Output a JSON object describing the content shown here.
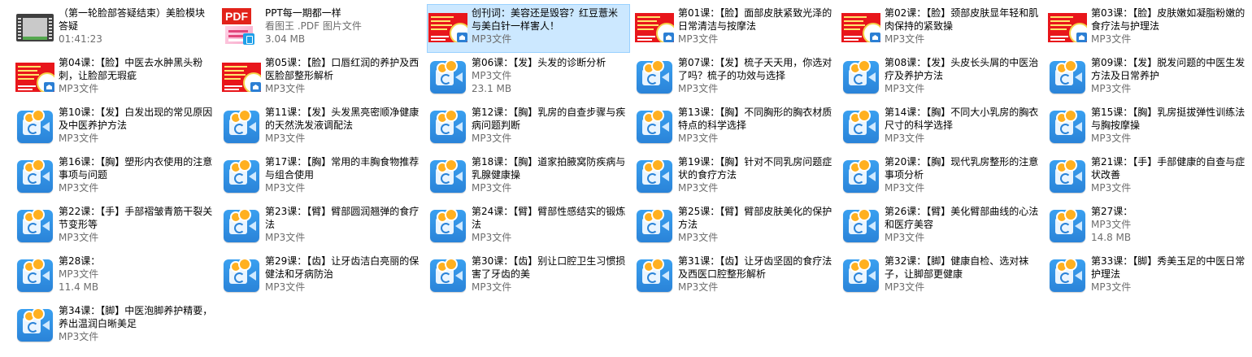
{
  "items": [
    {
      "name": "（第一轮脸部答疑结束）美脸模块答疑",
      "meta1": "01:41:23",
      "meta2": "",
      "icon": "video-thumbnail"
    },
    {
      "name": "PPT每一期都一样",
      "meta1": "看图王 .PDF 图片文件",
      "meta2": "3.04 MB",
      "icon": "pdf-thumbnail",
      "pdf_label": "PDF"
    },
    {
      "name": "创刊词：美容还是毁容？红豆薏米与美白针一样害人！",
      "meta1": "MP3文件",
      "meta2": "",
      "icon": "red-cover-thumbnail",
      "selected": true
    },
    {
      "name": "第01课：【脸】面部皮肤紧致光泽的日常清洁与按摩法",
      "meta1": "MP3文件",
      "meta2": "",
      "icon": "red-cover-thumbnail"
    },
    {
      "name": "第02课：【脸】颈部皮肤显年轻和肌肉保持的紧致操",
      "meta1": "MP3文件",
      "meta2": "",
      "icon": "red-cover-thumbnail"
    },
    {
      "name": "第03课：【脸】皮肤嫩如凝脂粉嫩的食疗法与护理法",
      "meta1": "MP3文件",
      "meta2": "",
      "icon": "red-cover-thumbnail"
    },
    {
      "name": "第04课：【脸】中医去水肿黑头粉刺，让脸部无瑕疵",
      "meta1": "MP3文件",
      "meta2": "",
      "icon": "red-cover-thumbnail"
    },
    {
      "name": "第05课：【脸】口唇红润的养护及西医脸部整形解析",
      "meta1": "MP3文件",
      "meta2": "",
      "icon": "red-cover-thumbnail"
    },
    {
      "name": "第06课：【发】头发的诊断分析",
      "meta1": "MP3文件",
      "meta2": "23.1 MB",
      "icon": "mp3-file-icon"
    },
    {
      "name": "第07课：【发】梳子天天用，你选对了吗？梳子的功效与选择",
      "meta1": "MP3文件",
      "meta2": "",
      "icon": "mp3-file-icon"
    },
    {
      "name": "第08课：【发】头皮长头屑的中医治疗及养护方法",
      "meta1": "MP3文件",
      "meta2": "",
      "icon": "mp3-file-icon"
    },
    {
      "name": "第09课：【发】脱发问题的中医生发方法及日常养护",
      "meta1": "MP3文件",
      "meta2": "",
      "icon": "mp3-file-icon"
    },
    {
      "name": "第10课：【发】白发出现的常见原因及中医养护方法",
      "meta1": "MP3文件",
      "meta2": "",
      "icon": "mp3-file-icon"
    },
    {
      "name": "第11课：【发】头发黑亮密顺净健康的天然洗发液调配法",
      "meta1": "MP3文件",
      "meta2": "",
      "icon": "mp3-file-icon"
    },
    {
      "name": "第12课：【胸】乳房的自查步骤与疾病问题判断",
      "meta1": "MP3文件",
      "meta2": "",
      "icon": "mp3-file-icon"
    },
    {
      "name": "第13课：【胸】不同胸形的胸衣材质特点的科学选择",
      "meta1": "MP3文件",
      "meta2": "",
      "icon": "mp3-file-icon"
    },
    {
      "name": "第14课：【胸】不同大小乳房的胸衣尺寸的科学选择",
      "meta1": "MP3文件",
      "meta2": "",
      "icon": "mp3-file-icon"
    },
    {
      "name": "第15课：【胸】乳房挺拔弹性训练法与胸按摩操",
      "meta1": "MP3文件",
      "meta2": "",
      "icon": "mp3-file-icon"
    },
    {
      "name": "第16课：【胸】塑形内衣使用的注意事项与问题",
      "meta1": "MP3文件",
      "meta2": "",
      "icon": "mp3-file-icon"
    },
    {
      "name": "第17课：【胸】常用的丰胸食物推荐与组合使用",
      "meta1": "MP3文件",
      "meta2": "",
      "icon": "mp3-file-icon"
    },
    {
      "name": "第18课：【胸】道家拍腋窝防疾病与乳腺健康操",
      "meta1": "MP3文件",
      "meta2": "",
      "icon": "mp3-file-icon"
    },
    {
      "name": "第19课：【胸】针对不同乳房问题症状的食疗方法",
      "meta1": "MP3文件",
      "meta2": "",
      "icon": "mp3-file-icon"
    },
    {
      "name": "第20课：【胸】现代乳房整形的注意事项分析",
      "meta1": "MP3文件",
      "meta2": "",
      "icon": "mp3-file-icon"
    },
    {
      "name": "第21课：【手】手部健康的自查与症状改善",
      "meta1": "MP3文件",
      "meta2": "",
      "icon": "mp3-file-icon"
    },
    {
      "name": "第22课：【手】手部褶皱青筋干裂关节变形等",
      "meta1": "MP3文件",
      "meta2": "",
      "icon": "mp3-file-icon"
    },
    {
      "name": "第23课：【臂】臂部圆润翘弹的食疗法",
      "meta1": "MP3文件",
      "meta2": "",
      "icon": "mp3-file-icon"
    },
    {
      "name": "第24课：【臂】臂部性感结实的锻炼法",
      "meta1": "MP3文件",
      "meta2": "",
      "icon": "mp3-file-icon"
    },
    {
      "name": "第25课：【臂】臂部皮肤美化的保护方法",
      "meta1": "MP3文件",
      "meta2": "",
      "icon": "mp3-file-icon"
    },
    {
      "name": "第26课：【臂】美化臂部曲线的心法和医疗美容",
      "meta1": "MP3文件",
      "meta2": "",
      "icon": "mp3-file-icon"
    },
    {
      "name": "第27课：",
      "meta1": "MP3文件",
      "meta2": "14.8 MB",
      "icon": "mp3-file-icon"
    },
    {
      "name": "第28课：",
      "meta1": "MP3文件",
      "meta2": "11.4 MB",
      "icon": "mp3-file-icon"
    },
    {
      "name": "第29课：【齿】让牙齿洁白亮丽的保健法和牙病防治",
      "meta1": "MP3文件",
      "meta2": "",
      "icon": "mp3-file-icon"
    },
    {
      "name": "第30课：【齿】别让口腔卫生习惯损害了牙齿的美",
      "meta1": "MP3文件",
      "meta2": "",
      "icon": "mp3-file-icon"
    },
    {
      "name": "第31课：【齿】让牙齿坚固的食疗法及西医口腔整形解析",
      "meta1": "MP3文件",
      "meta2": "",
      "icon": "mp3-file-icon"
    },
    {
      "name": "第32课：【脚】健康自检、选对袜子，让脚部更健康",
      "meta1": "MP3文件",
      "meta2": "",
      "icon": "mp3-file-icon"
    },
    {
      "name": "第33课：【脚】秀美玉足的中医日常护理法",
      "meta1": "MP3文件",
      "meta2": "",
      "icon": "mp3-file-icon"
    },
    {
      "name": "第34课：【脚】中医泡脚养护精要，养出温润白晰美足",
      "meta1": "MP3文件",
      "meta2": "",
      "icon": "mp3-file-icon"
    }
  ],
  "colors": {
    "selection_bg": "#cce8ff",
    "selection_border": "#99d1ff",
    "mp3_icon_blue": "#2a83d8",
    "cover_red": "#e8161b",
    "pdf_red": "#e2231a",
    "meta_gray": "#6d6d6d"
  }
}
